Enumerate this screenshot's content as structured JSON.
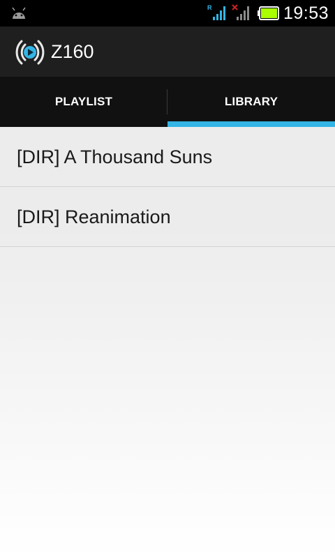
{
  "status_bar": {
    "time": "19:53",
    "roaming_indicator": "R",
    "icons": [
      "android-icon",
      "signal-roaming-icon",
      "signal-no-data-icon",
      "battery-icon"
    ],
    "battery_color": "#aaff00"
  },
  "action_bar": {
    "title": "Z160",
    "icon": "speaker-play-icon",
    "icon_color": "#33b5e5"
  },
  "tabs": [
    {
      "label": "PLAYLIST",
      "selected": false
    },
    {
      "label": "LIBRARY",
      "selected": true
    }
  ],
  "accent_color": "#33b5e5",
  "library": {
    "items": [
      {
        "label": "[DIR] A Thousand Suns"
      },
      {
        "label": "[DIR] Reanimation"
      }
    ]
  }
}
